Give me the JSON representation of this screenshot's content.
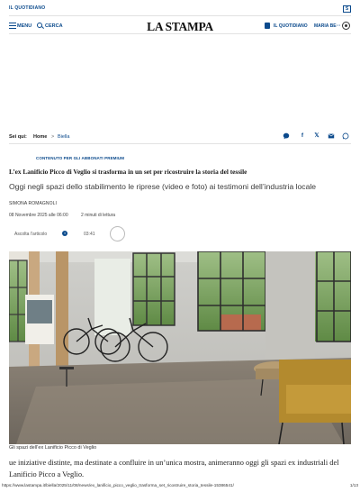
{
  "topbar": {
    "label": "IL QUOTIDIANO",
    "square_icon": "S"
  },
  "header": {
    "menu_label": "MENU",
    "search_label": "CERCA",
    "logo": "LA STAMPA",
    "quotidiano_label": "IL QUOTIDIANO",
    "user_label": "MARIA BE···"
  },
  "breadcrumb": {
    "prefix": "Sei qui:",
    "home": "Home",
    "separator": ">",
    "section": "Biella"
  },
  "share_icons": [
    "whatsapp-like-icon",
    "facebook-icon",
    "x-icon",
    "email-icon",
    "whatsapp-icon"
  ],
  "article": {
    "kicker": "CONTENUTO PER GLI ABBONATI PREMIUM",
    "title": "L’ex Lanificio Picco di Veglio si trasforma in un set per ricostruire la storia del tessile",
    "subtitle": "Oggi negli spazi dello stabilimento le riprese (video e foto) ai testimoni dell’industria locale",
    "author": "SIMONA ROMAGNOLI",
    "date": "08 Novembre 2025 alle 06:00",
    "read_time": "2 minuti di lettura",
    "listen_label": "Ascolta l’articolo",
    "duration": "03:41",
    "photo_caption": "Gli spazi dell’ex Lanificio Picco di Veglio",
    "paragraph": "ue iniziative distinte, ma destinate a confluire in un’unica mostra, animeranno oggi gli spazi ex industriali del Lanificio Picco a Veglio."
  },
  "footer": {
    "url": "https://www.lastampa.it/biella/2025/11/08/news/ex_lanificio_picco_veglio_trasforma_set_ricostruire_storia_tessile-15386541/",
    "page": "1/13"
  },
  "colors": {
    "brand_blue": "#0b4a8c",
    "border": "#e2e2e2"
  }
}
